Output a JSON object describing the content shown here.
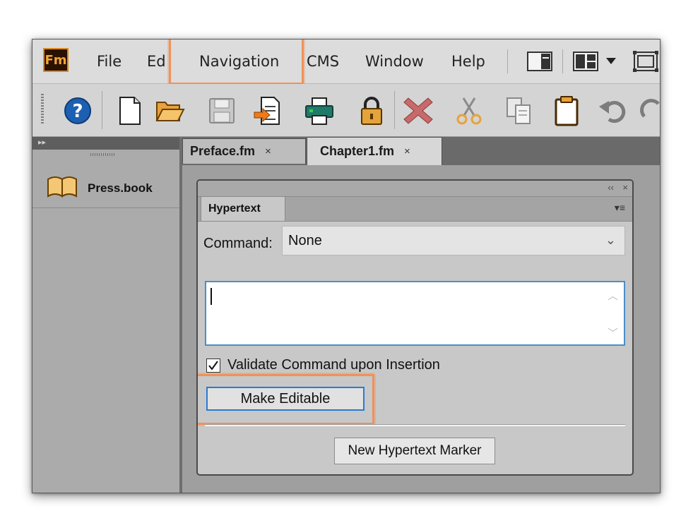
{
  "app": {
    "logo_text": "Fm"
  },
  "menubar": {
    "items": [
      {
        "label": "File"
      },
      {
        "label": "Edit"
      },
      {
        "label": "Navigation"
      },
      {
        "label": "CMS"
      },
      {
        "label": "Window"
      },
      {
        "label": "Help"
      }
    ],
    "icons": [
      "panel-layout-icon",
      "workspace-icon",
      "chevron-down-icon",
      "maximize-icon"
    ]
  },
  "toolbar": {
    "icons": [
      "help-icon",
      "new-document-icon",
      "open-folder-icon",
      "save-icon",
      "import-icon",
      "print-icon",
      "lock-icon",
      "delete-icon",
      "cut-icon",
      "copy-icon",
      "paste-icon",
      "undo-icon",
      "redo-icon"
    ]
  },
  "left_panel": {
    "book_label": "Press.book"
  },
  "tabs": [
    {
      "label": "Preface.fm",
      "close": "×"
    },
    {
      "label": "Chapter1.fm",
      "close": "×"
    }
  ],
  "hypertext_panel": {
    "tab_label": "Hypertext",
    "collapse_glyph": "‹‹",
    "close_glyph": "×",
    "menu_glyph": "▾≡",
    "command_label": "Command:",
    "command_value": "None",
    "command_text": "",
    "validate_label": "Validate Command upon Insertion",
    "validate_checked": true,
    "make_editable_label": "Make Editable",
    "new_marker_label": "New Hypertext Marker"
  },
  "colors": {
    "highlight": "#f0915a",
    "focus_blue": "#2a7ad4",
    "logo_orange": "#d98a1c"
  }
}
